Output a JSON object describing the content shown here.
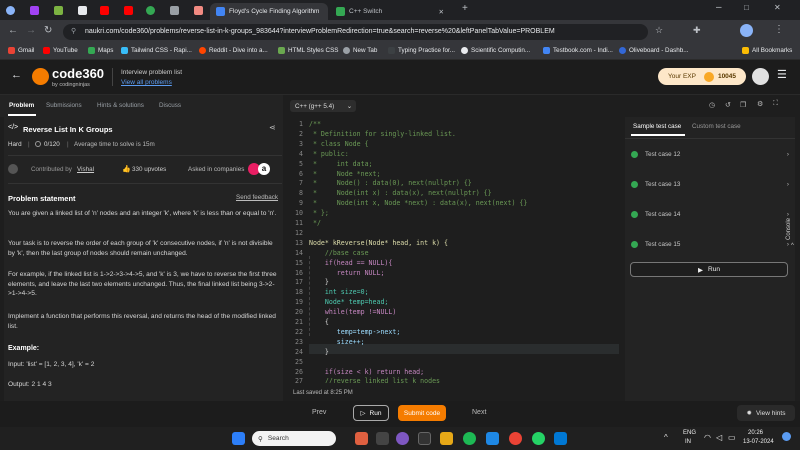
{
  "browser": {
    "tabs": [
      {
        "title": "Floyd's Cycle Finding Algorithm"
      },
      {
        "title": "C++ Switch"
      }
    ],
    "url": "naukri.com/code360/problems/reverse-list-in-k-groups_983644?interviewProblemRedirection=true&search=reverse%20&leftPanelTabValue=PROBLEM",
    "bookmarks": [
      "Gmail",
      "YouTube",
      "Maps",
      "Tailwind CSS - Rapi...",
      "Reddit - Dive into a...",
      "HTML Styles CSS",
      "New Tab",
      "Typing Practice for...",
      "Scientific Computin...",
      "Testbook.com - Indi...",
      "Oliveboard - Dashb...",
      "All Bookmarks"
    ]
  },
  "header": {
    "logo_text": "code360",
    "logo_sub": "by codingninjas",
    "crumb_title": "Interview problem list",
    "crumb_link": "View all problems",
    "exp_label": "Your EXP",
    "exp_value": "10045"
  },
  "left_tabs": [
    "Problem",
    "Submissions",
    "Hints & solutions",
    "Discuss"
  ],
  "problem": {
    "title": "Reverse List In K Groups",
    "difficulty": "Hard",
    "score": "0/120",
    "avg_time": "Average time to solve is 15m",
    "contributed": "Contributed by",
    "author": "Vishal",
    "upvotes": "330 upvotes",
    "asked": "Asked in companies",
    "statement_heading": "Problem statement",
    "feedback": "Send feedback",
    "p1": "You are given a linked list of 'n' nodes and an integer 'k', where 'k' is less than or equal to 'n'.",
    "p2": "Your task is to reverse the order of each group of 'k' consecutive nodes, if 'n' is not divisible by 'k', then the last group of nodes should remain unchanged.",
    "p3": "For example, if the linked list is 1->2->3->4->5, and 'k' is 3, we have to reverse the first three elements, and leave the last two elements unchanged. Thus, the final linked list being 3->2->1->4->5.",
    "p4": "Implement a function that performs this reversal, and returns the head of the modified linked list.",
    "example_heading": "Example:",
    "input": "Input: 'list' = [1, 2, 3, 4], 'k' = 2",
    "output": "Output: 2 1 4 3"
  },
  "editor": {
    "language": "C++ (g++ 5.4)",
    "last_saved": "Last saved at 8:25 PM",
    "lines": [
      {
        "n": "1",
        "t": "/**",
        "c": "#6a9955"
      },
      {
        "n": "2",
        "t": " * Definition for singly-linked list.",
        "c": "#6a9955"
      },
      {
        "n": "3",
        "t": " * class Node {",
        "c": "#6a9955"
      },
      {
        "n": "4",
        "t": " * public:",
        "c": "#6a9955"
      },
      {
        "n": "5",
        "t": " *     int data;",
        "c": "#6a9955"
      },
      {
        "n": "6",
        "t": " *     Node *next;",
        "c": "#6a9955"
      },
      {
        "n": "7",
        "t": " *     Node() : data(0), next(nullptr) {}",
        "c": "#6a9955"
      },
      {
        "n": "8",
        "t": " *     Node(int x) : data(x), next(nullptr) {}",
        "c": "#6a9955"
      },
      {
        "n": "9",
        "t": " *     Node(int x, Node *next) : data(x), next(next) {}",
        "c": "#6a9955"
      },
      {
        "n": "10",
        "t": " * };",
        "c": "#6a9955"
      },
      {
        "n": "11",
        "t": " */",
        "c": "#6a9955"
      },
      {
        "n": "12",
        "t": "",
        "c": "#d4d4d4"
      },
      {
        "n": "13",
        "t": "Node* kReverse(Node* head, int k) {",
        "c": "#dcdcaa"
      },
      {
        "n": "14",
        "t": "    //base case",
        "c": "#6a9955"
      },
      {
        "n": "15",
        "t": "    if(head == NULL){",
        "c": "#c586c0"
      },
      {
        "n": "16",
        "t": "       return NULL;",
        "c": "#c586c0"
      },
      {
        "n": "17",
        "t": "    }",
        "c": "#d4d4d4"
      },
      {
        "n": "18",
        "t": "    int size=0;",
        "c": "#4ec9b0"
      },
      {
        "n": "19",
        "t": "    Node* temp=head;",
        "c": "#4ec9b0"
      },
      {
        "n": "20",
        "t": "    while(temp !=NULL)",
        "c": "#c586c0"
      },
      {
        "n": "21",
        "t": "    {",
        "c": "#d4d4d4"
      },
      {
        "n": "22",
        "t": "       temp=temp->next;",
        "c": "#9cdcfe"
      },
      {
        "n": "23",
        "t": "       size++;",
        "c": "#9cdcfe"
      },
      {
        "n": "24",
        "t": "    }",
        "c": "#d4d4d4"
      },
      {
        "n": "25",
        "t": "",
        "c": "#d4d4d4"
      },
      {
        "n": "26",
        "t": "    if(size < k) return head;",
        "c": "#c586c0"
      },
      {
        "n": "27",
        "t": "    //reverse linked list k nodes",
        "c": "#6a9955"
      }
    ]
  },
  "right": {
    "tab1": "Sample test case",
    "tab2": "Custom test case",
    "tests": [
      "Test case 12",
      "Test case 13",
      "Test case 14",
      "Test case 15"
    ],
    "run": "Run",
    "console": "Console"
  },
  "bottom": {
    "prev": "Prev",
    "run": "Run",
    "submit": "Submit code",
    "next": "Next",
    "hints": "View hints"
  },
  "taskbar": {
    "search": "Search",
    "lang1": "ENG",
    "lang2": "IN",
    "time": "20:26",
    "date": "13-07-2024"
  }
}
